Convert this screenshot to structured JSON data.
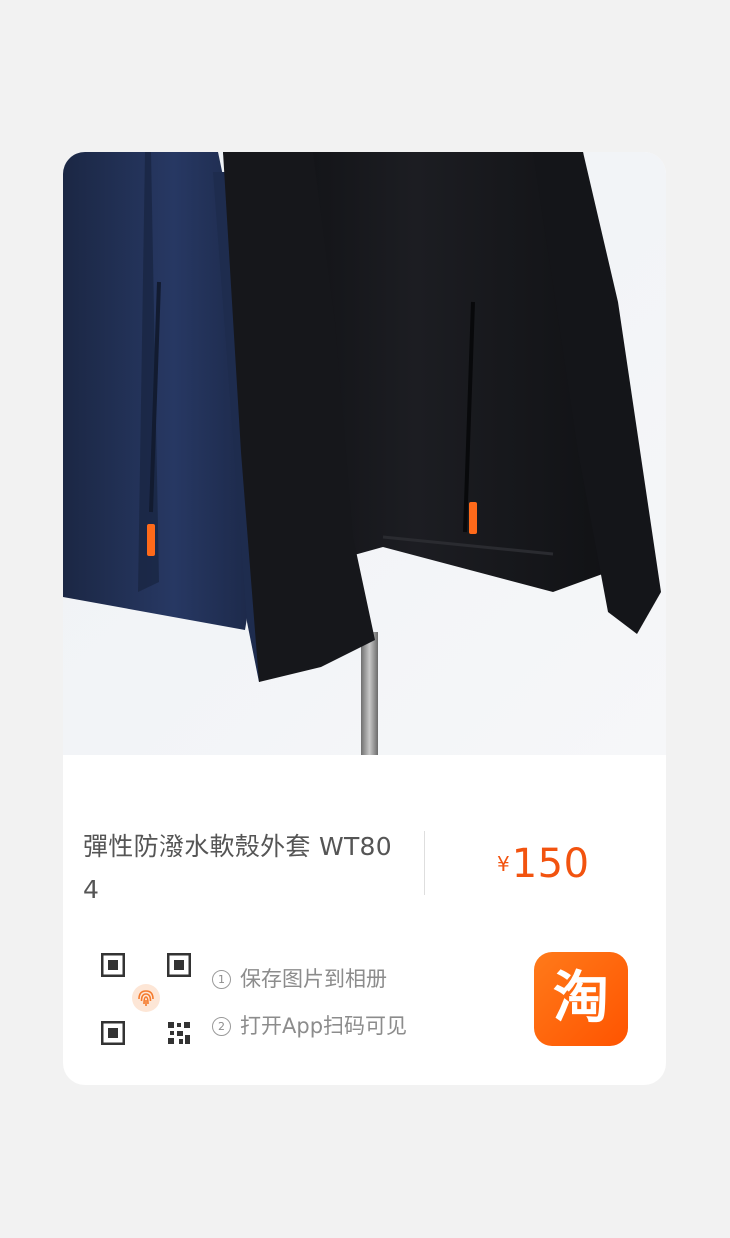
{
  "product": {
    "title": "彈性防潑水軟殼外套 WT804",
    "price_currency": "¥",
    "price_amount": "150",
    "image_icon": "jacket-photo"
  },
  "instructions": {
    "step1_num": "1",
    "step1": "保存图片到相册",
    "step2_num": "2",
    "step2": "打开App扫码可见"
  },
  "app_icon": {
    "name": "taobao-icon",
    "glyph": "淘",
    "color": "#ff5a00"
  },
  "colors": {
    "price": "#f2530f",
    "background": "#f2f2f2",
    "card": "#ffffff"
  }
}
